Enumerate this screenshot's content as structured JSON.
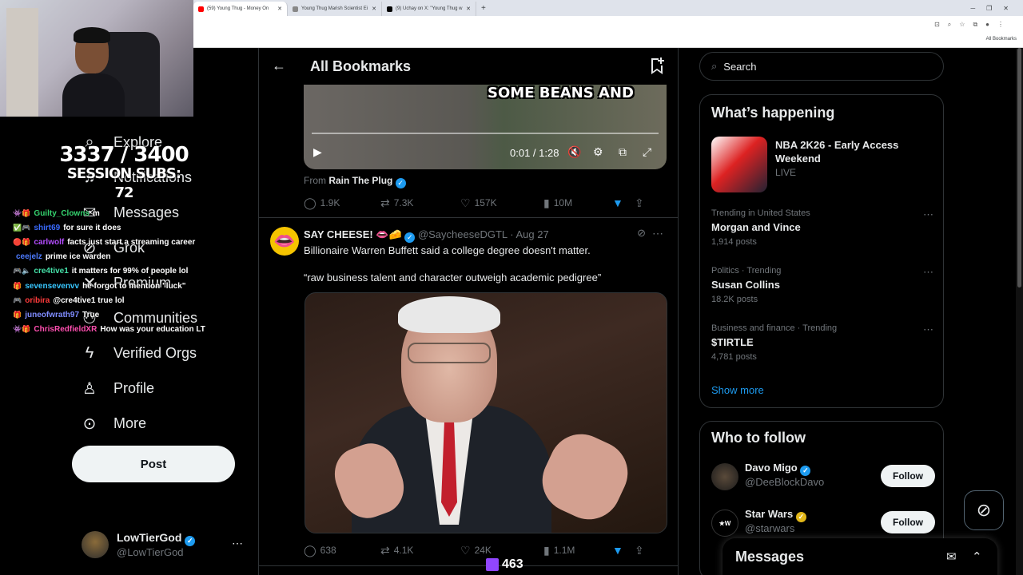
{
  "browser": {
    "tabs": [
      {
        "label": "(59) Young Thug - Money On",
        "favicon": "youtube"
      },
      {
        "label": "Young Thug Marish Scientist Ei",
        "favicon": "generic"
      },
      {
        "label": "(9) Uchay on X: \"Young Thug w",
        "favicon": "x"
      }
    ],
    "bookmarks_folder": "All Bookmarks"
  },
  "overlay": {
    "subgoal_count": "3337 / 3400",
    "subgoal_label": "SESSION SUBS: 72",
    "chat": [
      {
        "user": "Guilty_Clowns",
        "msg": "m",
        "color": "#35d36e",
        "badges": "👾🎁"
      },
      {
        "user": "shirt69",
        "msg": "for sure it does",
        "color": "#3a6bff",
        "badges": "✅🎮"
      },
      {
        "user": "carlwolf",
        "msg": "facts just start a streaming career",
        "color": "#b44dff",
        "badges": "🔴🎁"
      },
      {
        "user": "ceejelz",
        "msg": "prime ice warden",
        "color": "#4d7bff",
        "badges": ""
      },
      {
        "user": "cre4tive1",
        "msg": "it matters for 99% of people lol",
        "color": "#45e0a8",
        "badges": "🎮🔈"
      },
      {
        "user": "sevensevenvv",
        "msg": "he forgot to mention \"luck\"",
        "color": "#38c7ff",
        "badges": "🎁"
      },
      {
        "user": "oribira",
        "msg": "@cre4tive1 true lol",
        "color": "#ff3b3b",
        "badges": "🎮"
      },
      {
        "user": "juneofwrath97",
        "msg": "True",
        "color": "#7f8cff",
        "badges": "🎁"
      },
      {
        "user": "ChrisRedfieldXR",
        "msg": "How was your education LT",
        "color": "#ff4fb0",
        "badges": "👾🎁"
      }
    ],
    "viewer_count": "463"
  },
  "nav": {
    "items": [
      {
        "label": "Explore",
        "icon": "search-icon",
        "glyph": "⌕"
      },
      {
        "label": "Notifications",
        "icon": "bell-icon",
        "glyph": "🔔"
      },
      {
        "label": "Messages",
        "icon": "mail-icon",
        "glyph": "✉"
      },
      {
        "label": "Grok",
        "icon": "grok-icon",
        "glyph": "⊘"
      },
      {
        "label": "Premium",
        "icon": "x-logo-icon",
        "glyph": "𝕏"
      },
      {
        "label": "Communities",
        "icon": "people-icon",
        "glyph": "👥"
      },
      {
        "label": "Verified Orgs",
        "icon": "lightning-icon",
        "glyph": "ϟ"
      },
      {
        "label": "Profile",
        "icon": "person-icon",
        "glyph": "👤"
      },
      {
        "label": "More",
        "icon": "more-circle-icon",
        "glyph": "⋯"
      }
    ],
    "post_label": "Post",
    "account": {
      "name": "LowTierGod",
      "handle": "@LowTierGod"
    }
  },
  "main": {
    "title": "All Bookmarks",
    "video_tweet": {
      "caption": "SOME BEANS AND",
      "time": "0:01 / 1:28",
      "from_prefix": "From",
      "from_name": "Rain The Plug",
      "replies": "1.9K",
      "reposts": "7.3K",
      "likes": "157K",
      "views": "10M"
    },
    "tweet": {
      "name": "SAY CHEESE! 👄🧀",
      "handle": "@SaycheeseDGTL",
      "date": "· Aug 27",
      "text": "Billionaire Warren Buffett said a college degree doesn't matter.",
      "quote": "“raw business talent and character outweigh academic pedigree”",
      "replies": "638",
      "reposts": "4.1K",
      "likes": "24K",
      "views": "1.1M"
    }
  },
  "sidebar": {
    "search_placeholder": "Search",
    "happening_title": "What’s happening",
    "featured": {
      "title": "NBA 2K26 - Early Access Weekend",
      "status": "LIVE"
    },
    "trends": [
      {
        "category": "Trending in United States",
        "name": "Morgan and Vince",
        "posts": "1,914 posts"
      },
      {
        "category": "Politics · Trending",
        "name": "Susan Collins",
        "posts": "18.2K posts"
      },
      {
        "category": "Business and finance · Trending",
        "name": "$TIRTLE",
        "posts": "4,781 posts"
      }
    ],
    "show_more": "Show more",
    "wtf_title": "Who to follow",
    "follow": [
      {
        "name": "Davo Migo",
        "handle": "@DeeBlockDavo",
        "button": "Follow",
        "badge": "blue"
      },
      {
        "name": "Star Wars",
        "handle": "@starwars",
        "button": "Follow",
        "badge": "gold"
      }
    ],
    "messages_title": "Messages"
  },
  "colors": {
    "accent": "#1d9bf0",
    "background": "#000000",
    "border": "#2f3336",
    "muted": "#71767b"
  }
}
